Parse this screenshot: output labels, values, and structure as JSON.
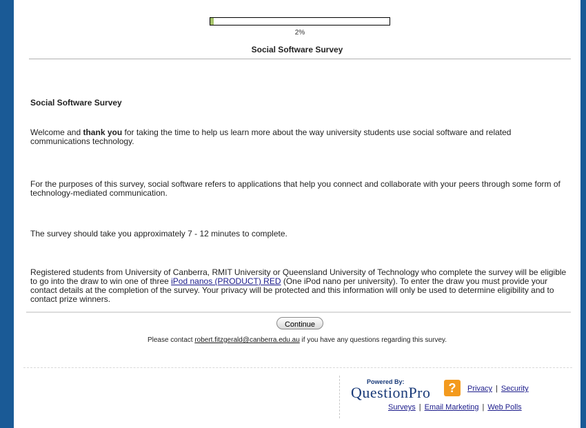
{
  "progress": {
    "percent_text": "2%",
    "fraction": 0.02
  },
  "header": {
    "title": "Social Software Survey"
  },
  "content": {
    "heading": "Social Software Survey",
    "p1_before": "Welcome and ",
    "p1_bold": "thank you",
    "p1_after": " for taking the time to help us learn more about the way university students use social software and related communications technology.",
    "p2": "For the purposes of this survey, social software refers to applications that help you connect and collaborate with your peers through some form of technology-mediated communication.",
    "p3": "The survey should take you approximately 7 - 12 minutes to complete.",
    "p4_before": "Registered students from University of Canberra, RMIT University or Queensland University of Technology who complete the survey will be eligible to go into the draw to win one of three ",
    "p4_link": "iPod nanos (PRODUCT) RED",
    "p4_after": " (One iPod nano per university). To enter the draw you must provide your contact details at the completion of the survey. Your privacy will be protected and this information will only be used to determine eligibility and to contact prize winners."
  },
  "actions": {
    "continue_label": "Continue"
  },
  "contact": {
    "before": "Please contact ",
    "email": "robert.fitzgerald@canberra.edu.au",
    "after": " if you have any questions regarding this survey."
  },
  "footer": {
    "powered_by": "Powered By:",
    "logo_text": "QuestionPro",
    "badge_glyph": "?",
    "links_row1": [
      "Privacy",
      "Security"
    ],
    "links_row2": [
      "Surveys",
      "Email Marketing",
      "Web Polls"
    ],
    "separator": "|"
  },
  "colors": {
    "frame": "#1a5a96",
    "progress_fill": "#a6c46a",
    "logo": "#1a3b79",
    "badge": "#f39a1e"
  }
}
